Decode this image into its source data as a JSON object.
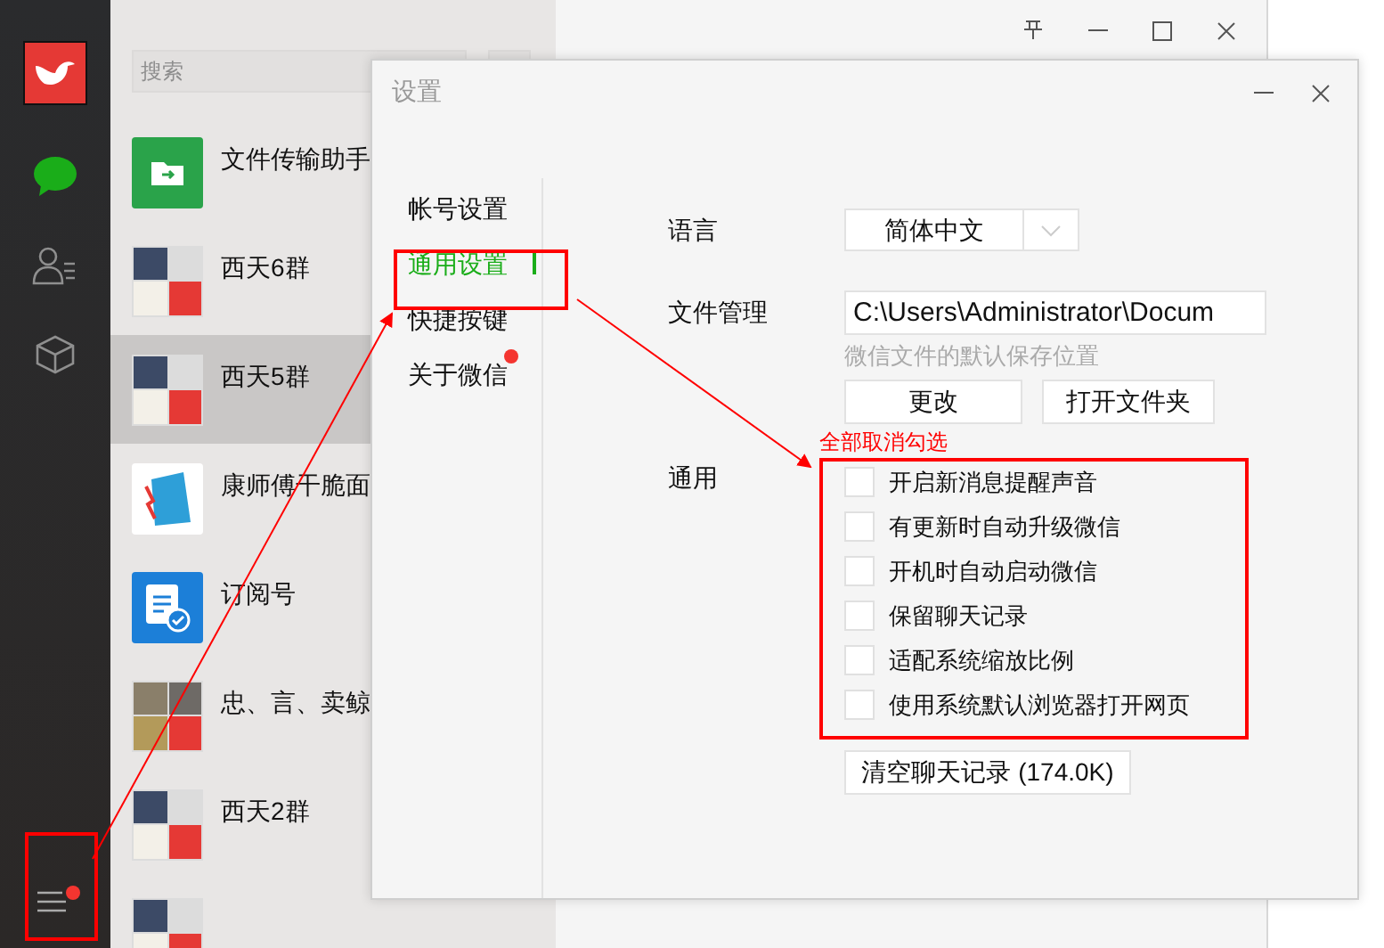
{
  "main_window": {
    "sidebar": {
      "items": [
        {
          "kind": "chat",
          "selected": true
        },
        {
          "kind": "contacts",
          "selected": false
        },
        {
          "kind": "favorites",
          "selected": false
        }
      ],
      "menu": {
        "has_badge": true
      }
    },
    "search": {
      "placeholder": "搜索"
    },
    "chats": [
      {
        "name": "文件传输助手",
        "kind": "file",
        "selected": false
      },
      {
        "name": "西天6群",
        "kind": "group",
        "selected": false
      },
      {
        "name": "西天5群",
        "kind": "group",
        "selected": true
      },
      {
        "name": "康师傅干脆面",
        "kind": "brand",
        "selected": false
      },
      {
        "name": "订阅号",
        "kind": "subscription",
        "selected": false
      },
      {
        "name": "忠、言、卖鲸",
        "kind": "group4",
        "selected": false
      },
      {
        "name": "西天2群",
        "kind": "group",
        "selected": false
      },
      {
        "kind": "group",
        "selected": false
      }
    ]
  },
  "settings_dialog": {
    "title": "设置",
    "nav": [
      {
        "label": "帐号设置",
        "selected": false,
        "badge": false
      },
      {
        "label": "通用设置",
        "selected": true,
        "badge": false
      },
      {
        "label": "快捷按键",
        "selected": false,
        "badge": false
      },
      {
        "label": "关于微信",
        "selected": false,
        "badge": true
      }
    ],
    "language": {
      "label": "语言",
      "value": "简体中文"
    },
    "file_management": {
      "label": "文件管理",
      "path": "C:\\Users\\Administrator\\Docum",
      "hint": "微信文件的默认保存位置",
      "buttons": [
        "更改",
        "打开文件夹"
      ]
    },
    "general": {
      "label": "通用",
      "options": [
        {
          "label": "开启新消息提醒声音",
          "checked": false
        },
        {
          "label": "有更新时自动升级微信",
          "checked": false
        },
        {
          "label": "开机时自动启动微信",
          "checked": false
        },
        {
          "label": "保留聊天记录",
          "checked": false
        },
        {
          "label": "适配系统缩放比例",
          "checked": false
        },
        {
          "label": "使用系统默认浏览器打开网页",
          "checked": false
        }
      ],
      "clear_button": "清空聊天记录 (174.0K)"
    }
  },
  "annotation": {
    "note": "全部取消勾选"
  }
}
